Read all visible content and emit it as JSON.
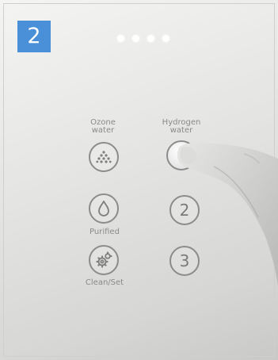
{
  "step_badge": "2",
  "indicator_dots": 4,
  "buttons": {
    "ozone": {
      "label_line1": "Ozone",
      "label_line2": "water",
      "icon": "droplets-triangle-icon"
    },
    "hydrogen": {
      "label_line1": "Hydrogen",
      "label_line2": "water",
      "state": "pressed"
    },
    "purified": {
      "label": "Purified",
      "icon": "water-drop-icon"
    },
    "two": {
      "number": "2"
    },
    "clean_set": {
      "label": "Clean/Set",
      "icon": "gears-icon"
    },
    "three": {
      "number": "3"
    }
  },
  "colors": {
    "badge": "#4a90d9",
    "panel": "#e9e9e7",
    "button_outline": "#8c8c8c"
  }
}
